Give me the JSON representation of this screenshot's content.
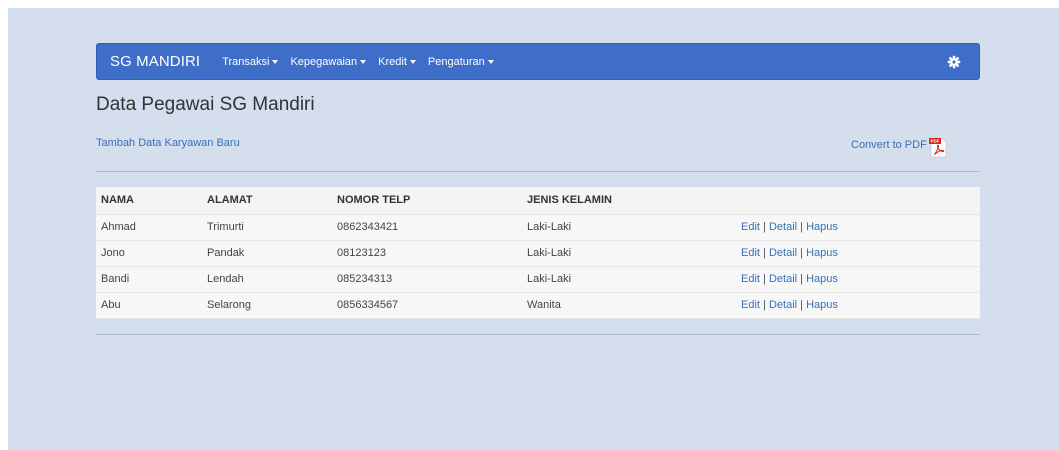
{
  "navbar": {
    "brand": "SG MANDIRI",
    "items": [
      {
        "label": "Transaksi"
      },
      {
        "label": "Kepegawaian"
      },
      {
        "label": "Kredit"
      },
      {
        "label": "Pengaturan"
      }
    ],
    "settings_icon": "gear-icon"
  },
  "page": {
    "title": "Data Pegawai SG Mandiri",
    "add_link": "Tambah Data Karyawan Baru",
    "pdf_link": "Convert to PDF",
    "pdf_icon": "pdf-icon"
  },
  "table": {
    "headers": [
      "NAMA",
      "ALAMAT",
      "NOMOR TELP",
      "JENIS KELAMIN",
      ""
    ],
    "rows": [
      {
        "nama": "Ahmad",
        "alamat": "Trimurti",
        "telp": "0862343421",
        "jk": "Laki-Laki"
      },
      {
        "nama": "Jono",
        "alamat": "Pandak",
        "telp": "08123123",
        "jk": "Laki-Laki"
      },
      {
        "nama": "Bandi",
        "alamat": "Lendah",
        "telp": "085234313",
        "jk": "Laki-Laki"
      },
      {
        "nama": "Abu",
        "alamat": "Selarong",
        "telp": "0856334567",
        "jk": "Wanita"
      }
    ],
    "actions": {
      "edit": "Edit",
      "detail": "Detail",
      "hapus": "Hapus",
      "separator": "|"
    }
  },
  "colors": {
    "navbar": "#3e6ec7",
    "link": "#3a6fbd",
    "background": "#d4deec"
  }
}
